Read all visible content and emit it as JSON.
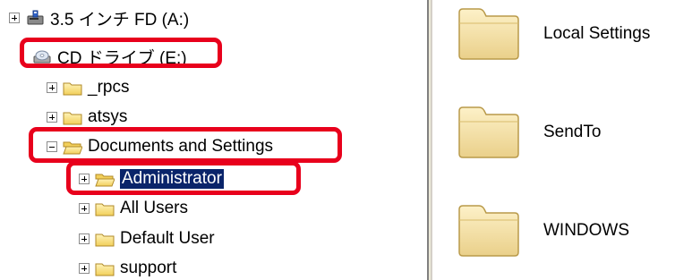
{
  "tree": {
    "items": [
      {
        "label": "3.5 インチ FD (A:)",
        "icon": "floppy-drive-icon",
        "expander": "plus"
      },
      {
        "label": "CD ドライブ (E:)",
        "icon": "cd-drive-icon",
        "expander": "none"
      },
      {
        "label": "_rpcs",
        "icon": "folder-icon",
        "expander": "plus"
      },
      {
        "label": "atsys",
        "icon": "folder-icon",
        "expander": "plus"
      },
      {
        "label": "Documents and Settings",
        "icon": "open-folder-icon",
        "expander": "minus"
      },
      {
        "label": "Administrator",
        "icon": "folder-icon",
        "expander": "plus",
        "selected": true
      },
      {
        "label": "All Users",
        "icon": "folder-icon",
        "expander": "plus"
      },
      {
        "label": "Default User",
        "icon": "folder-icon",
        "expander": "plus"
      },
      {
        "label": "support",
        "icon": "folder-icon",
        "expander": "plus"
      }
    ]
  },
  "list": {
    "items": [
      {
        "label": "Local Settings",
        "icon": "large-folder-icon"
      },
      {
        "label": "SendTo",
        "icon": "large-folder-icon"
      },
      {
        "label": "WINDOWS",
        "icon": "large-folder-icon"
      }
    ]
  },
  "colors": {
    "highlight": "#e8001c",
    "selection": "#0a246a",
    "folder_fill": "#f8e27f"
  }
}
